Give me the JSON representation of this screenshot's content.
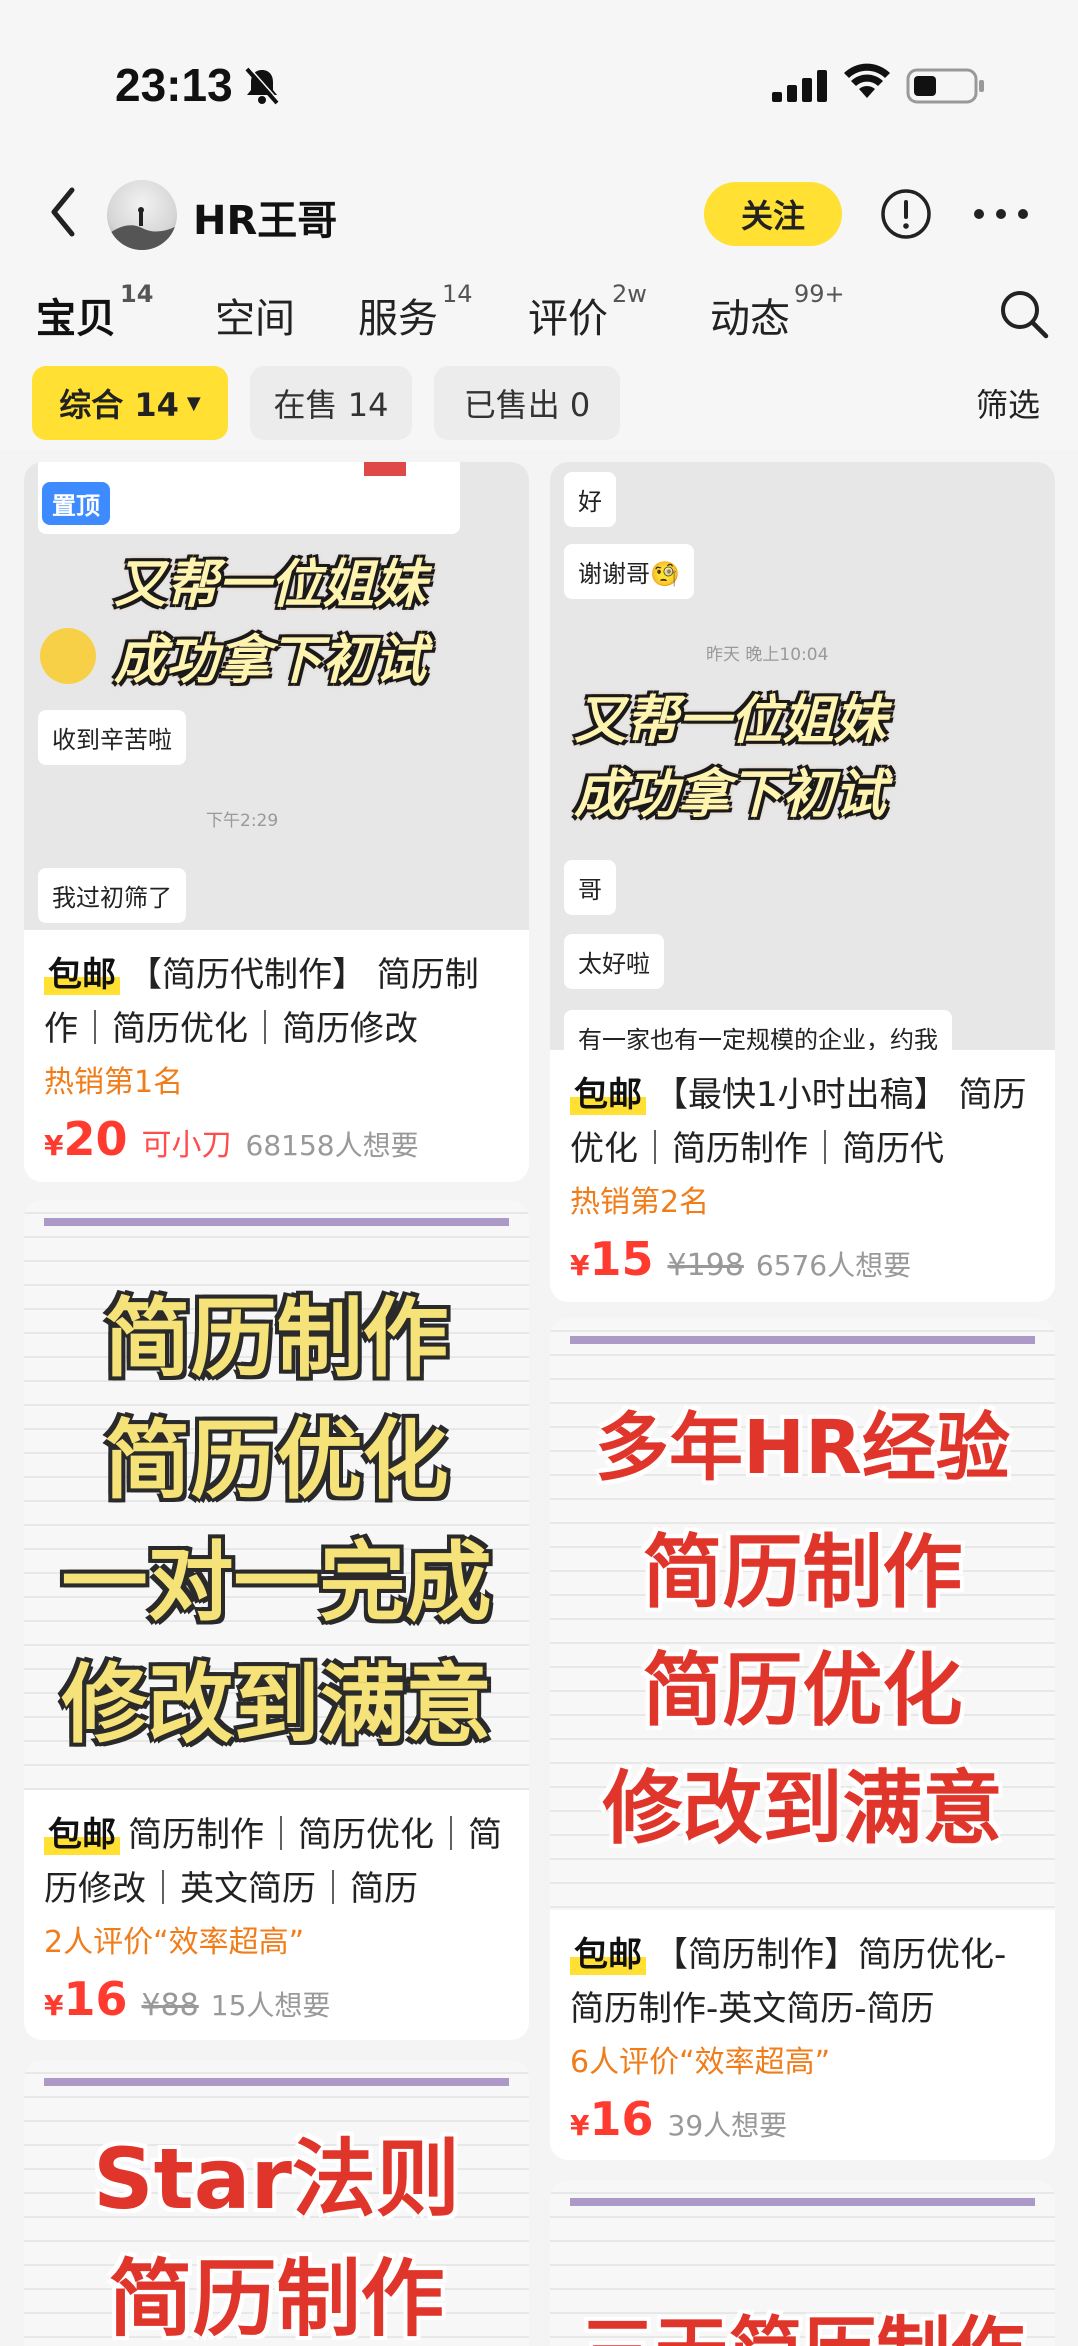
{
  "status_bar": {
    "time": "23:13"
  },
  "header": {
    "shop_name": "HR王哥",
    "follow_label": "关注"
  },
  "tabs": [
    {
      "label": "宝贝",
      "badge": "14"
    },
    {
      "label": "空间",
      "badge": ""
    },
    {
      "label": "服务",
      "badge": "14"
    },
    {
      "label": "评价",
      "badge": "2w"
    },
    {
      "label": "动态",
      "badge": "99+"
    }
  ],
  "filters": {
    "chips": [
      "综合 14",
      "在售 14",
      "已售出 0"
    ],
    "filter_label": "筛选"
  },
  "cards": [
    {
      "pin": "置顶",
      "image": {
        "overlay_line1": "又帮一位姐妹",
        "overlay_line2": "成功拿下初试",
        "bubble1": "收到辛苦啦",
        "time": "下午2:29",
        "bubble2": "我过初筛了"
      },
      "free_ship": "包邮",
      "title": "【简历代制作】 简历制作｜简历优化｜简历修改",
      "tag": "热销第1名",
      "currency": "¥",
      "price": "20",
      "bargain": "可小刀",
      "original": "",
      "wants": "68158人想要"
    },
    {
      "image": {
        "bubble1": "好",
        "bubble2": "谢谢哥🧐",
        "time": "昨天 晚上10:04",
        "overlay_line1": "又帮一位姐妹",
        "overlay_line2": "成功拿下初试",
        "bubble3": "哥",
        "bubble4": "太好啦",
        "bubble5": "有一家也有一定规模的企业，约我"
      },
      "free_ship": "包邮",
      "title": "【最快1小时出稿】 简历优化｜简历制作｜简历代",
      "tag": "热销第2名",
      "currency": "¥",
      "price": "15",
      "original": "¥198",
      "wants": "6576人想要"
    },
    {
      "image": {
        "lines": [
          "简历制作",
          "简历优化",
          "一对一完成",
          "修改到满意"
        ]
      },
      "free_ship": "包邮",
      "title": "简历制作｜简历优化｜简历修改｜英文简历｜简历",
      "tag": "2人评价“效率超高”",
      "currency": "¥",
      "price": "16",
      "original": "¥88",
      "wants": "15人想要"
    },
    {
      "image": {
        "lines": [
          "多年HR经验",
          "简历制作",
          "简历优化",
          "修改到满意"
        ]
      },
      "free_ship": "包邮",
      "title": "【简历制作】简历优化-简历制作-英文简历-简历",
      "tag": "6人评价“效率超高”",
      "currency": "¥",
      "price": "16",
      "original": "",
      "wants": "39人想要"
    },
    {
      "image": {
        "lines": [
          "Star法则",
          "简历制作"
        ]
      }
    },
    {
      "image": {
        "lines": [
          "三天简历制作"
        ]
      }
    }
  ]
}
